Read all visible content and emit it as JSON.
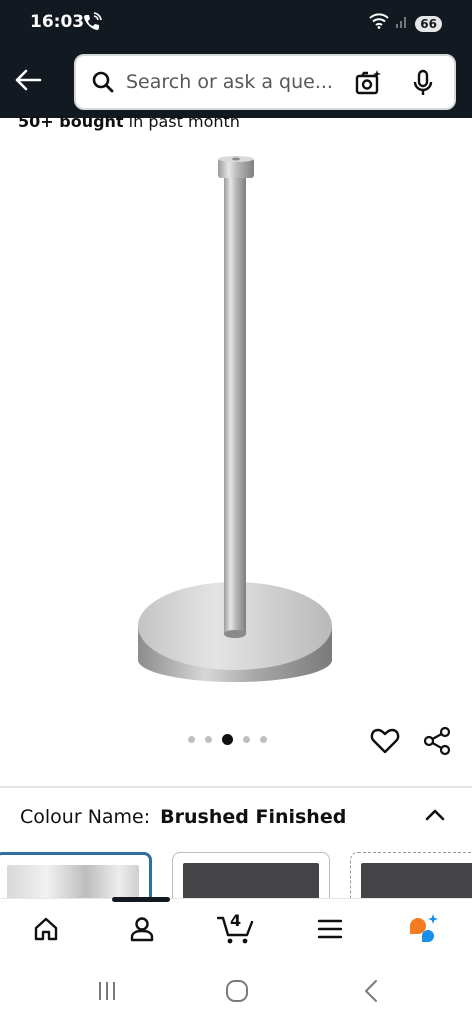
{
  "status_bar": {
    "time": "16:03",
    "battery": "66"
  },
  "search": {
    "placeholder": "Search or ask a que..."
  },
  "product": {
    "bought_bold": "50+ bought",
    "bought_rest": " in past month",
    "image_count": 5,
    "active_image_index": 2
  },
  "variation": {
    "label": "Colour Name:",
    "value": "Brushed Finished"
  },
  "bottom_nav": {
    "cart_count": "4"
  },
  "colors": {
    "header_bg": "#131921",
    "accent": "#2f6f9f",
    "alexa_orange": "#f47b20",
    "alexa_blue": "#1b8ee8"
  }
}
